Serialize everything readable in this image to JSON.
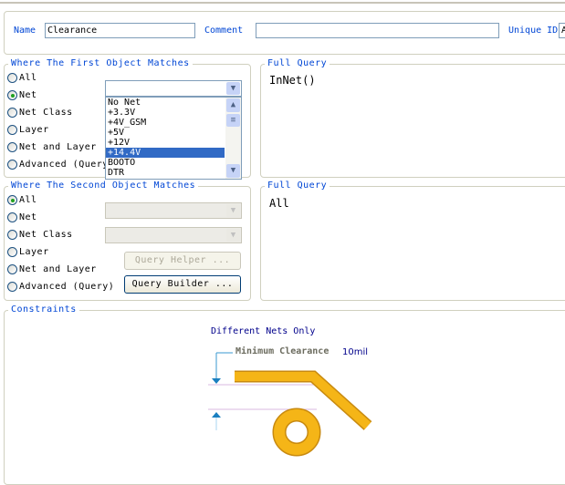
{
  "header": {
    "name_label": "Name",
    "name_value": "Clearance",
    "comment_label": "Comment",
    "comment_value": "",
    "unique_id_label": "Unique ID",
    "unique_id_value": "A"
  },
  "first": {
    "title": "Where The First Object Matches",
    "options": [
      "All",
      "Net",
      "Net Class",
      "Layer",
      "Net and Layer",
      "Advanced (Query)"
    ],
    "selected": "Net",
    "net_value": "",
    "net_list": [
      "No Net",
      "+3.3V",
      "+4V_GSM",
      "+5V",
      "+12V",
      "+14.4V",
      "BOOTO",
      "DTR"
    ],
    "highlighted": "+14.4V"
  },
  "first_query": {
    "title": "Full Query",
    "text": "InNet()"
  },
  "second": {
    "title": "Where The Second Object Matches",
    "options": [
      "All",
      "Net",
      "Net Class",
      "Layer",
      "Net and Layer",
      "Advanced (Query)"
    ],
    "selected": "All",
    "query_helper": "Query Helper ...",
    "query_builder": "Query Builder ..."
  },
  "second_query": {
    "title": "Full Query",
    "text": "All"
  },
  "constraints": {
    "title": "Constraints",
    "mode": "Different Nets Only",
    "min_clearance_label": "Minimum Clearance",
    "min_clearance_value": "10mil"
  },
  "colors": {
    "label_blue": "#0046d5",
    "trace": "#f5b517",
    "selection": "#316ac5"
  }
}
